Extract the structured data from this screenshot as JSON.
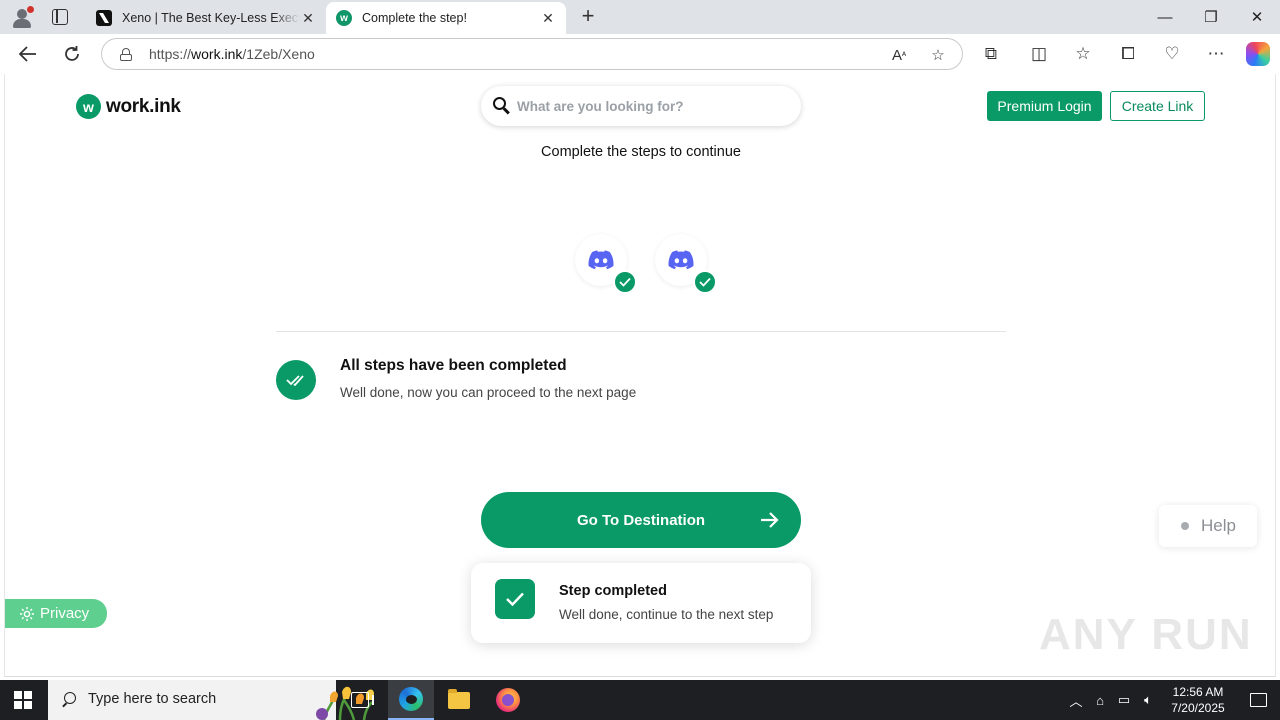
{
  "browser": {
    "tabs": [
      {
        "title": "Xeno | The Best Key-Less Executor",
        "active": false
      },
      {
        "title": "Complete the step!",
        "active": true
      }
    ],
    "address": {
      "scheme": "https://",
      "host": "work.ink",
      "path": "/1Zeb/Xeno"
    }
  },
  "header": {
    "logo_text": "work.ink",
    "logo_mark": "w",
    "search_placeholder": "What are you looking for?",
    "premium_login_label": "Premium Login",
    "create_link_label": "Create Link"
  },
  "main": {
    "subtitle": "Complete the steps to continue",
    "steps": [
      {
        "icon": "discord-icon",
        "completed": true
      },
      {
        "icon": "discord-icon",
        "completed": true
      }
    ],
    "status_title": "All steps have been completed",
    "status_subtitle": "Well done, now you can proceed to the next page",
    "destination_button_label": "Go To Destination"
  },
  "help_label": "Help",
  "toast": {
    "title": "Step completed",
    "subtitle": "Well done, continue to the next step"
  },
  "privacy_label": "Privacy",
  "watermark_text": "ANY RUN",
  "taskbar": {
    "search_placeholder": "Type here to search",
    "time": "12:56 AM",
    "date": "7/20/2025"
  },
  "colors": {
    "brand_green": "#0a9a68",
    "privacy_green": "#5fcf8f",
    "discord_blurple": "#5865f2",
    "taskbar_bg": "#1d1f23"
  }
}
